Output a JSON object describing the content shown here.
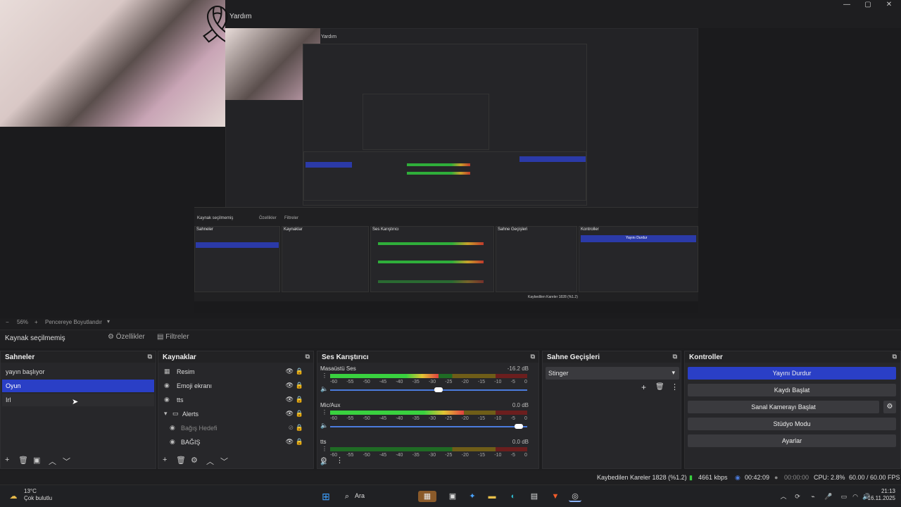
{
  "window": {
    "menu_help": "Yardım",
    "minimize": "—",
    "maximize": "▢",
    "close": "✕"
  },
  "preview": {
    "nested_title": "Yardım",
    "inner_no_source": "Kaynak seçilmemiş",
    "inner_properties": "Özellikler",
    "inner_filters": "Filtreler",
    "inner_scenes_hdr": "Sahneler",
    "inner_sources_hdr": "Kaynaklar",
    "inner_mixer_hdr": "Ses Karıştırıcı",
    "inner_transitions_hdr": "Sahne Geçişleri",
    "inner_controls_hdr": "Kontroller",
    "inner_stop_stream": "Yayını Durdur",
    "inner_dropped": "Kaybedilen Kareler 1828 (%1.2)"
  },
  "zoom": {
    "minus": "−",
    "value": "56%",
    "plus": "+",
    "mode": "Pencereye Boyutlandır"
  },
  "source_bar": {
    "no_source": "Kaynak seçilmemiş",
    "properties": "Özellikler",
    "filters": "Filtreler"
  },
  "scenes": {
    "title": "Sahneler",
    "items": [
      {
        "label": "yayın başlıyor"
      },
      {
        "label": "Oyun"
      },
      {
        "label": "Irl"
      }
    ]
  },
  "sources": {
    "title": "Kaynaklar",
    "items": [
      {
        "label": "Resim"
      },
      {
        "label": "Emoji ekranı"
      },
      {
        "label": "tts"
      },
      {
        "label": "Alerts"
      },
      {
        "label": "Bağış Hedefi"
      },
      {
        "label": "BAĞIŞ"
      }
    ]
  },
  "mixer": {
    "title": "Ses Karıştırıcı",
    "channels": [
      {
        "name": "Masaüstü Ses",
        "db": "-16.2 dB",
        "level": 0.55,
        "volume": 0.57
      },
      {
        "name": "Mic/Aux",
        "db": "0.0 dB",
        "level": 0.68,
        "volume": 0.98
      },
      {
        "name": "tts",
        "db": "0.0 dB",
        "level": 0.0,
        "volume": 0.98
      }
    ],
    "scale": [
      "-60",
      "-55",
      "-50",
      "-45",
      "-40",
      "-35",
      "-30",
      "-25",
      "-20",
      "-15",
      "-10",
      "-5",
      "0"
    ]
  },
  "transitions": {
    "title": "Sahne Geçişleri",
    "selected": "Stinger"
  },
  "controls": {
    "title": "Kontroller",
    "stop_stream": "Yayını Durdur",
    "start_record": "Kaydı Başlat",
    "start_virtualcam": "Sanal Kamerayı Başlat",
    "studio_mode": "Stüdyo Modu",
    "settings": "Ayarlar"
  },
  "status": {
    "dropped": "Kaybedilen Kareler 1828 (%1.2)",
    "bitrate": "4661 kbps",
    "stream_time": "00:42:09",
    "record_time": "00:00:00",
    "cpu": "CPU: 2.8%",
    "fps": "60.00 / 60.00 FPS"
  },
  "taskbar": {
    "temp": "13°C",
    "weather": "Çok bulutlu",
    "search": "Ara",
    "time": "21:13",
    "date": "16.11.2025"
  },
  "colors": {
    "accent": "#2a3fc6",
    "panel": "#27272a",
    "background": "#1d1d1f"
  }
}
